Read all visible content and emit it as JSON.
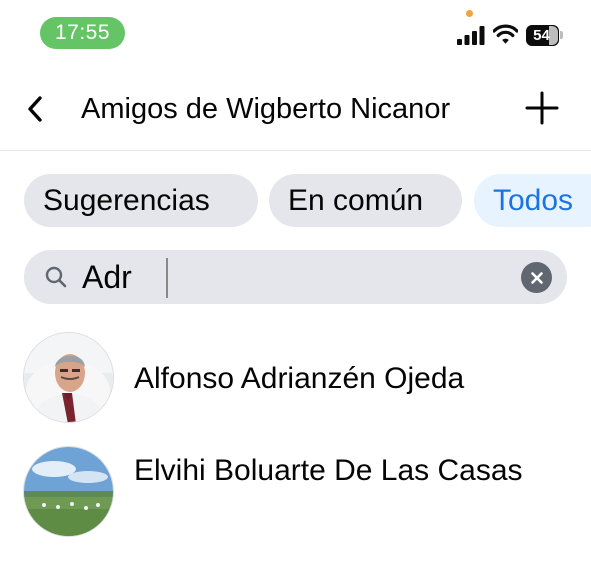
{
  "status_bar": {
    "time": "17:55",
    "battery_level": "54",
    "icons": [
      "signal-icon",
      "wifi-icon",
      "battery-icon"
    ],
    "time_pill_color": "#65c466"
  },
  "header": {
    "back_icon": "chevron-left-icon",
    "title": "Amigos de Wigberto Nicanor",
    "add_icon": "plus-icon"
  },
  "filters": {
    "chips": [
      {
        "label": "Sugerencias",
        "selected": false
      },
      {
        "label": "En común",
        "selected": false
      },
      {
        "label": "Todos",
        "selected": true
      }
    ],
    "selected_color": "#1b74e4"
  },
  "search": {
    "value": "Adr",
    "search_icon": "search-icon",
    "clear_icon": "clear-icon"
  },
  "friends": [
    {
      "name": "Alfonso Adrianzén Ojeda",
      "avatar": "avatar-photo-man"
    },
    {
      "name": "Elvihi Boluarte De Las Casas",
      "avatar": "avatar-photo-field"
    }
  ]
}
